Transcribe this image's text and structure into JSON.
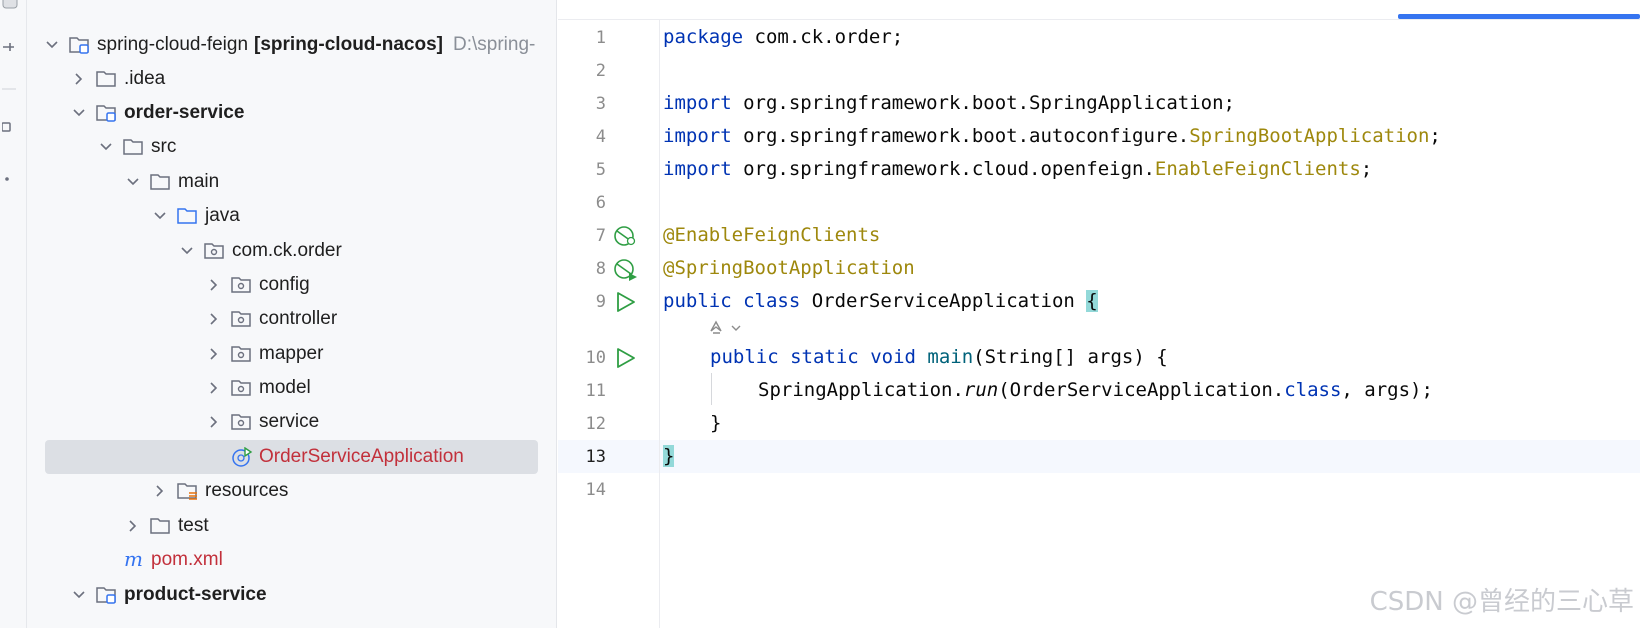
{
  "project_tree": {
    "root": {
      "label": "spring-cloud-feign",
      "module": "[spring-cloud-nacos]",
      "path": "D:\\spring-"
    },
    "items": [
      {
        "label": ".idea"
      },
      {
        "label": "order-service"
      },
      {
        "label": "src"
      },
      {
        "label": "main"
      },
      {
        "label": "java"
      },
      {
        "label": "com.ck.order"
      },
      {
        "label": "config"
      },
      {
        "label": "controller"
      },
      {
        "label": "mapper"
      },
      {
        "label": "model"
      },
      {
        "label": "service"
      },
      {
        "label": "OrderServiceApplication"
      },
      {
        "label": "resources"
      },
      {
        "label": "test"
      },
      {
        "label": "pom.xml"
      },
      {
        "label": "product-service"
      }
    ]
  },
  "editor": {
    "line_numbers": [
      "1",
      "2",
      "3",
      "4",
      "5",
      "6",
      "7",
      "8",
      "9",
      "10",
      "11",
      "12",
      "13",
      "14"
    ],
    "current_line": "13",
    "code": {
      "l1": {
        "kw": "package",
        "rest": " com.ck.order;"
      },
      "l3": {
        "kw": "import",
        "rest": " org.springframework.boot.SpringApplication;"
      },
      "l4": {
        "kw": "import",
        "rest": " org.springframework.boot.autoconfigure.",
        "ann": "SpringBootApplication",
        "end": ";"
      },
      "l5": {
        "kw": "import",
        "rest": " org.springframework.cloud.openfeign.",
        "ann": "EnableFeignClients",
        "end": ";"
      },
      "l7": {
        "ann": "@EnableFeignClients"
      },
      "l8": {
        "ann": "@SpringBootApplication"
      },
      "l9": {
        "kw1": "public",
        "kw2": "class",
        "name": " OrderServiceApplication ",
        "brace": "{"
      },
      "l10": {
        "kw1": "public",
        "kw2": "static",
        "kw3": "void",
        "fn": "main",
        "rest": "(String[] args) {"
      },
      "l11": {
        "cls": "SpringApplication.",
        "method": "run",
        "mid": "(OrderServiceApplication.",
        "kw": "class",
        "end": ", args);"
      },
      "l12": {
        "text": "}"
      },
      "l13": {
        "text": "}"
      }
    }
  },
  "watermark": "CSDN @曾经的三心草",
  "colors": {
    "keyword": "#0033b3",
    "annotation": "#9e880d",
    "function": "#00627a",
    "selected_file": "#c2303b",
    "accent": "#3574f0"
  }
}
